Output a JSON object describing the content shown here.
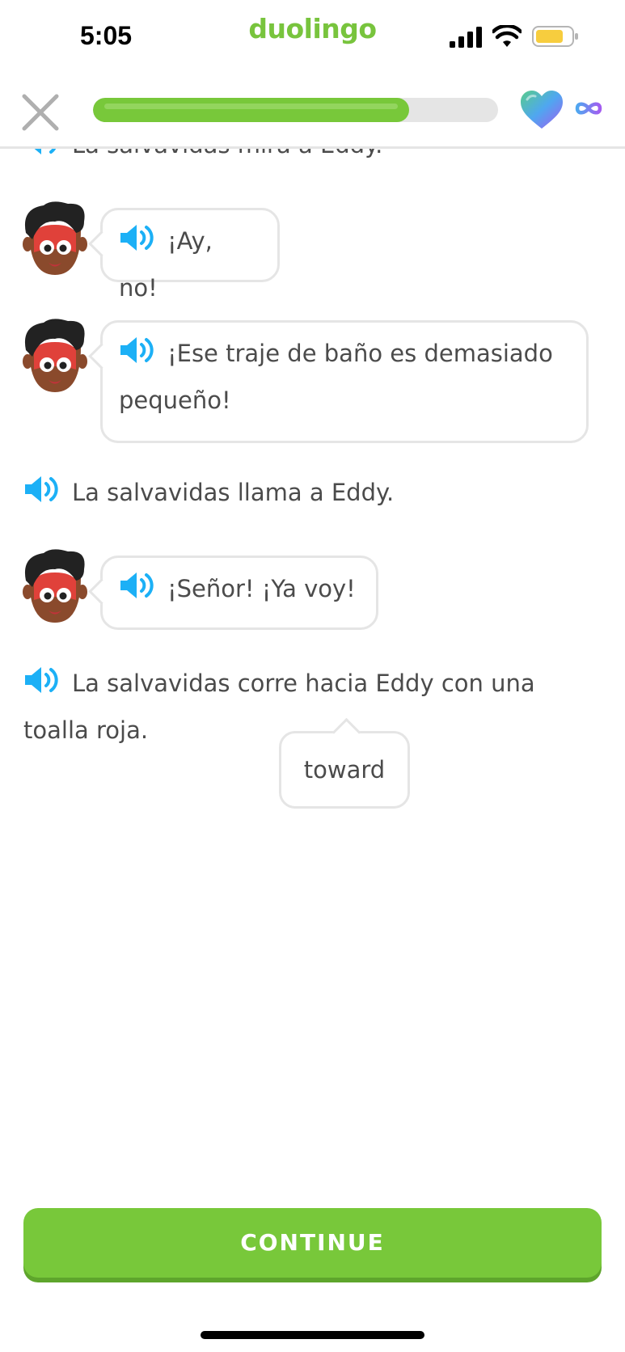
{
  "status_bar": {
    "time": "5:05",
    "app_name": "duolingo",
    "icons": [
      "signal-icon",
      "wifi-icon",
      "battery-icon"
    ]
  },
  "header": {
    "close_icon": "close-icon",
    "progress": 0.78,
    "hearts_icon": "heart-icon",
    "hearts_value_icon": "infinity-icon"
  },
  "story": {
    "partial_line": "La salvavidas mira a Eddy.",
    "lines": [
      {
        "type": "speech",
        "text": "¡Ay, no!"
      },
      {
        "type": "speech",
        "text_1": "¡Ese traje de baño es demasiado",
        "text_2": "pequeño!"
      },
      {
        "type": "narration",
        "text": "La salvavidas llama a Eddy."
      },
      {
        "type": "speech",
        "text": "¡Señor! ¡Ya voy!"
      },
      {
        "type": "narration",
        "text_1": "La salvavidas corre hacia Eddy con una",
        "text_2": "toalla roja."
      }
    ],
    "tooltip": "toward"
  },
  "footer": {
    "continue_label": "CONTINUE"
  },
  "colors": {
    "brand_green": "#78c83a",
    "speaker_blue": "#1cb0f6",
    "border_gray": "#e5e5e5"
  }
}
